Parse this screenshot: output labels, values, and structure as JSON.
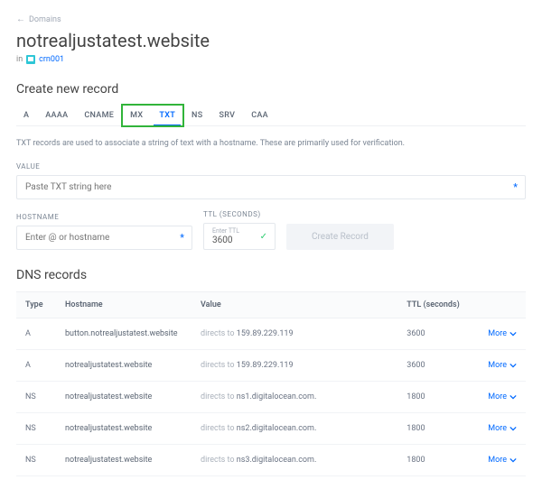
{
  "nav": {
    "back": "Domains"
  },
  "header": {
    "title": "notrealjustatest.website",
    "in": "in",
    "project": "crn001"
  },
  "create": {
    "heading": "Create new record",
    "tabs": [
      "A",
      "AAAA",
      "CNAME",
      "MX",
      "TXT",
      "NS",
      "SRV",
      "CAA"
    ],
    "active_tab": "TXT",
    "desc": "TXT records are used to associate a string of text with a hostname. These are primarily used for verification.",
    "value_label": "VALUE",
    "value_placeholder": "Paste TXT string here",
    "hostname_label": "HOSTNAME",
    "hostname_placeholder": "Enter @ or hostname",
    "ttl_label": "TTL (SECONDS)",
    "ttl_inner_label": "Enter TTL",
    "ttl_value": "3600",
    "button": "Create Record"
  },
  "records": {
    "heading": "DNS records",
    "columns": {
      "type": "Type",
      "hostname": "Hostname",
      "value": "Value",
      "ttl": "TTL (seconds)"
    },
    "directs": "directs to",
    "more": "More",
    "rows": [
      {
        "type": "A",
        "hostname": "button.notrealjustatest.website",
        "value": "159.89.229.119",
        "ttl": "3600"
      },
      {
        "type": "A",
        "hostname": "notrealjustatest.website",
        "value": "159.89.229.119",
        "ttl": "3600"
      },
      {
        "type": "NS",
        "hostname": "notrealjustatest.website",
        "value": "ns1.digitalocean.com.",
        "ttl": "1800"
      },
      {
        "type": "NS",
        "hostname": "notrealjustatest.website",
        "value": "ns2.digitalocean.com.",
        "ttl": "1800"
      },
      {
        "type": "NS",
        "hostname": "notrealjustatest.website",
        "value": "ns3.digitalocean.com.",
        "ttl": "1800"
      }
    ]
  }
}
